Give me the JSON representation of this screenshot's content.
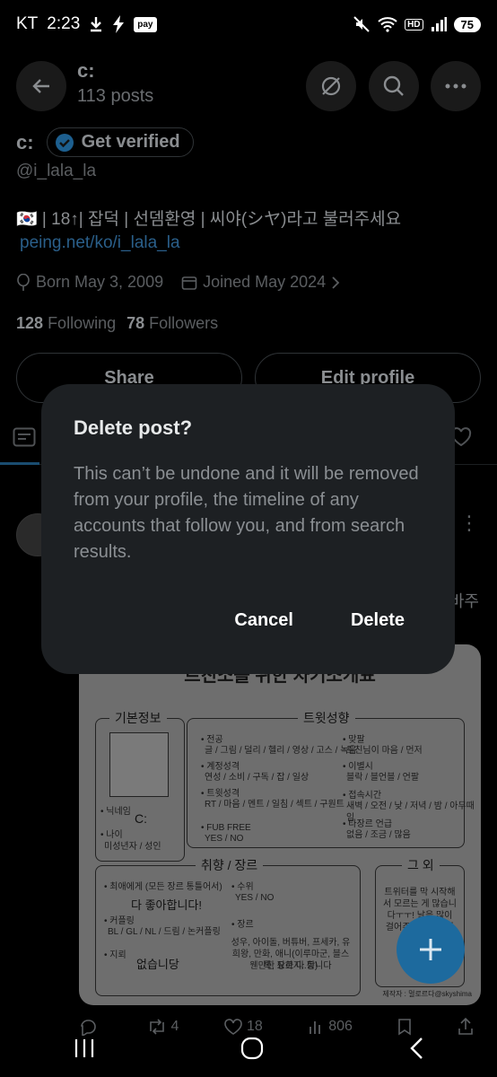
{
  "status_bar": {
    "carrier": "KT",
    "time": "2:23",
    "pay_badge": "pay",
    "hd_badge": "HD",
    "battery": "75",
    "wifi_badge": "6"
  },
  "header": {
    "title": "c:",
    "post_count": "113 posts"
  },
  "profile": {
    "name": "c:",
    "verify_label": "Get verified",
    "handle": "@i_lala_la",
    "bio": "🇰🇷 | 18↑| 잡덕 | 선뎀환영 | 씨야(シヤ)라고 불러주세요",
    "bio_link": "peing.net/ko/i_lala_la",
    "born": "Born May 3, 2009",
    "joined": "Joined May 2024",
    "following_count": "128",
    "following_label": "Following",
    "followers_count": "78",
    "followers_label": "Followers",
    "share_label": "Share",
    "edit_label": "Edit profile"
  },
  "post": {
    "more": "⋮",
    "trailing_text": "바주",
    "image": {
      "title": "트친소를 위한 자기소개표",
      "section_basic": "기본정보",
      "section_tweet": "트윗성향",
      "section_taste": "취향 / 장르",
      "section_etc": "그 외",
      "nickname_label": "• 닉네임",
      "nickname_value": "C:",
      "age_label": "• 나이",
      "age_value": "미성년자 / 성인",
      "field_major": "• 전공",
      "field_major_value": "글 / 그림 / 덜리 / 헬리 / 영상 / 고스 / 녹음",
      "field_personality": "• 계정성격",
      "field_personality_value": "연성 / 소비 / 구독 / 잡 / 일상",
      "field_tweet": "• 트윗성격",
      "field_tweet_value": "RT / 마음 / 멘트 / 일침 / 섹트 / 구원트",
      "field_fub": "• FUB FREE",
      "field_fub_value": "YES / NO",
      "field_mukbang": "• 맞팔",
      "field_mukbang_value": "트친님이 마음 / 먼저",
      "field_unfollow": "• 이별시",
      "field_unfollow_value": "블락 / 블언블 / 언팔",
      "field_time": "• 접속시간",
      "field_time_value": "새벽 / 오전 / 낮 / 저녁 / 밤 / 아무때임",
      "field_mention": "• 타장르 언급",
      "field_mention_value": "없음 / 조금 / 많음",
      "taste_all": "• 최애에게 (모든 장르 통틀어서)",
      "taste_all_value": "다 좋아합니다!",
      "taste_couple": "• 커플링",
      "taste_couple_value": "BL / GL / NL / 드림 / 논커플링",
      "taste_land": "• 지뢰",
      "taste_land_value": "없습니당",
      "taste_age": "• 수위",
      "taste_age_value": "YES / NO",
      "taste_genre": "• 장르",
      "taste_genre_value": "성우, 아이돌, 버튜버, 프세카, 유희왕, 만화, 애니(이루마군, 블스톡, 요하지..등)",
      "taste_genre_value2": "웬만한 장르 다 합니다",
      "etc_text": "트위터를 막 시작해서 모르는 게 많습니다ㅜㅜ! 날을 많이 걸어주세요 언젠가",
      "watermark": "제작자 : 멀로르다@skyshima"
    },
    "replies": "",
    "reposts": "4",
    "likes": "18",
    "views": "806"
  },
  "dialog": {
    "title": "Delete post?",
    "body": "This can’t be undone and it will be removed from your profile, the timeline of any accounts that follow you, and from search results.",
    "cancel_label": "Cancel",
    "delete_label": "Delete"
  },
  "icons": {
    "back": "back-arrow-icon",
    "no-grok": "slashed-circle-icon",
    "search": "search-icon",
    "more": "more-horizontal-icon"
  }
}
